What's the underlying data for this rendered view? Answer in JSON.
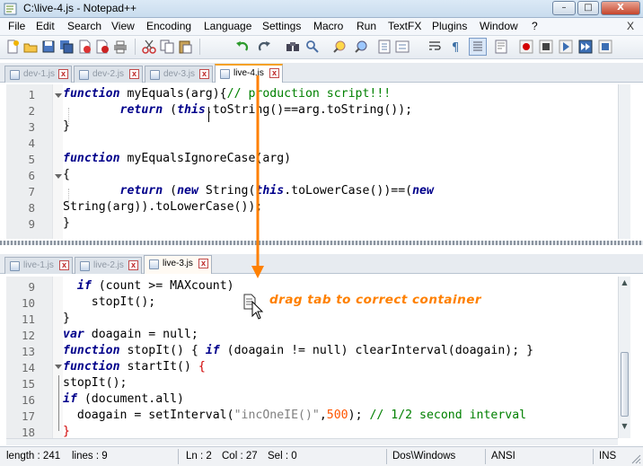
{
  "window": {
    "title": "C:\\live-4.js - Notepad++",
    "min": "–",
    "max": "□",
    "close": "X"
  },
  "menu": [
    "File",
    "Edit",
    "Search",
    "View",
    "Encoding",
    "Language",
    "Settings",
    "Macro",
    "Run",
    "TextFX",
    "Plugins",
    "Window",
    "?"
  ],
  "menu_close": "X",
  "top_tabs": [
    {
      "label": "dev-1.js",
      "active": false
    },
    {
      "label": "dev-2.js",
      "active": false
    },
    {
      "label": "dev-3.js",
      "active": false
    },
    {
      "label": "live-4.js",
      "active": true
    }
  ],
  "bottom_tabs": [
    {
      "label": "live-1.js",
      "active": false
    },
    {
      "label": "live-2.js",
      "active": false
    },
    {
      "label": "live-3.js",
      "active": true
    }
  ],
  "top_line_numbers": [
    "1",
    "2",
    "3",
    "4",
    "5",
    "6",
    "7",
    "8",
    "9"
  ],
  "bottom_line_numbers": [
    "9",
    "10",
    "11",
    "12",
    "13",
    "14",
    "15",
    "16",
    "17",
    "18"
  ],
  "annotation": "drag tab to correct container",
  "status": {
    "length": "length : 241",
    "lines": "lines : 9",
    "ln": "Ln : 2",
    "col": "Col : 27",
    "sel": "Sel : 0",
    "eol": "Dos\\Windows",
    "encoding": "ANSI",
    "mode": "INS"
  },
  "code_top": [
    [
      [
        "kw",
        "function"
      ],
      [
        "t",
        " myEquals(arg){"
      ],
      [
        "cmt",
        "// production script!!!"
      ]
    ],
    [
      [
        "t",
        "        "
      ],
      [
        "kw",
        "return"
      ],
      [
        "t",
        " ("
      ],
      [
        "kw",
        "this"
      ],
      [
        "t",
        ".toString()==arg.toString());"
      ]
    ],
    [
      [
        "t",
        "}"
      ]
    ],
    [
      [
        "t",
        ""
      ]
    ],
    [
      [
        "kw",
        "function"
      ],
      [
        "t",
        " myEqualsIgnoreCase(arg)"
      ]
    ],
    [
      [
        "t",
        "{"
      ]
    ],
    [
      [
        "t",
        "        "
      ],
      [
        "kw",
        "return"
      ],
      [
        "t",
        " ("
      ],
      [
        "kw",
        "new"
      ],
      [
        "t",
        " String("
      ],
      [
        "kw",
        "this"
      ],
      [
        "t",
        ".toLowerCase())==("
      ],
      [
        "kw",
        "new"
      ]
    ],
    [
      [
        "t",
        "String(arg)).toLowerCase());"
      ]
    ],
    [
      [
        "t",
        "}"
      ]
    ]
  ],
  "code_bottom": [
    [
      [
        "t",
        "  "
      ],
      [
        "kw",
        "if"
      ],
      [
        "t",
        " (count >= MAXcount)"
      ]
    ],
    [
      [
        "t",
        "    stopIt();"
      ]
    ],
    [
      [
        "t",
        "}"
      ]
    ],
    [
      [
        "kw",
        "var"
      ],
      [
        "t",
        " doagain = null;"
      ]
    ],
    [
      [
        "kw",
        "function"
      ],
      [
        "t",
        " stopIt() { "
      ],
      [
        "kw",
        "if"
      ],
      [
        "t",
        " (doagain != null) clearInterval(doagain); }"
      ]
    ],
    [
      [
        "kw",
        "function"
      ],
      [
        "t",
        " startIt() "
      ],
      [
        "red",
        "{"
      ]
    ],
    [
      [
        "t",
        "stopIt();"
      ]
    ],
    [
      [
        "kw",
        "if"
      ],
      [
        "t",
        " (document.all)"
      ]
    ],
    [
      [
        "t",
        "  doagain = setInterval("
      ],
      [
        "str",
        "\"incOneIE()\""
      ],
      [
        "t",
        ","
      ],
      [
        "num",
        "500"
      ],
      [
        "t",
        "); "
      ],
      [
        "cmt",
        "// 1/2 second interval"
      ]
    ],
    [
      [
        "red",
        "}"
      ]
    ]
  ],
  "colors": {
    "keyword": "#00008b",
    "comment": "#008000",
    "string": "#808080",
    "number": "#ff5500",
    "annotation": "#ff8000",
    "active_tab_accent": "#f5a123"
  }
}
